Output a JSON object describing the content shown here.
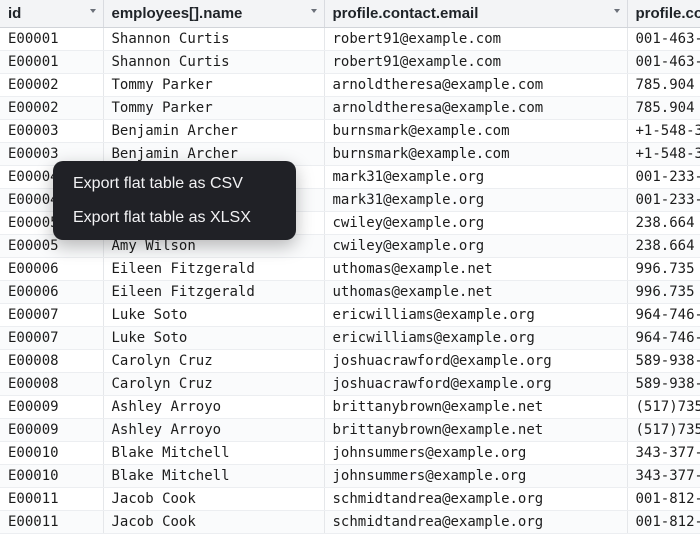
{
  "columns": [
    {
      "key": "id",
      "label": "id"
    },
    {
      "key": "name",
      "label": "employees[].name"
    },
    {
      "key": "email",
      "label": "profile.contact.email"
    },
    {
      "key": "phone",
      "label": "profile.co"
    }
  ],
  "rows": [
    [
      "E00001",
      "Shannon Curtis",
      "robert91@example.com",
      "001-463-"
    ],
    [
      "E00001",
      "Shannon Curtis",
      "robert91@example.com",
      "001-463-"
    ],
    [
      "E00002",
      "Tommy Parker",
      "arnoldtheresa@example.com",
      "785.904"
    ],
    [
      "E00002",
      "Tommy Parker",
      "arnoldtheresa@example.com",
      "785.904"
    ],
    [
      "E00003",
      "Benjamin Archer",
      "burnsmark@example.com",
      "+1-548-3"
    ],
    [
      "E00003",
      "Benjamin Archer",
      "burnsmark@example.com",
      "+1-548-3"
    ],
    [
      "E00004",
      "",
      "mark31@example.org",
      "001-233-"
    ],
    [
      "E00004",
      "",
      "mark31@example.org",
      "001-233-"
    ],
    [
      "E00005",
      "",
      "cwiley@example.org",
      "238.664"
    ],
    [
      "E00005",
      "Amy Wilson",
      "cwiley@example.org",
      "238.664"
    ],
    [
      "E00006",
      "Eileen Fitzgerald",
      "uthomas@example.net",
      "996.735"
    ],
    [
      "E00006",
      "Eileen Fitzgerald",
      "uthomas@example.net",
      "996.735"
    ],
    [
      "E00007",
      "Luke Soto",
      "ericwilliams@example.org",
      "964-746-"
    ],
    [
      "E00007",
      "Luke Soto",
      "ericwilliams@example.org",
      "964-746-"
    ],
    [
      "E00008",
      "Carolyn Cruz",
      "joshuacrawford@example.org",
      "589-938-"
    ],
    [
      "E00008",
      "Carolyn Cruz",
      "joshuacrawford@example.org",
      "589-938-"
    ],
    [
      "E00009",
      "Ashley Arroyo",
      "brittanybrown@example.net",
      "(517)735"
    ],
    [
      "E00009",
      "Ashley Arroyo",
      "brittanybrown@example.net",
      "(517)735"
    ],
    [
      "E00010",
      "Blake Mitchell",
      "johnsummers@example.org",
      "343-377-"
    ],
    [
      "E00010",
      "Blake Mitchell",
      "johnsummers@example.org",
      "343-377-"
    ],
    [
      "E00011",
      "Jacob Cook",
      "schmidtandrea@example.org",
      "001-812-"
    ],
    [
      "E00011",
      "Jacob Cook",
      "schmidtandrea@example.org",
      "001-812-"
    ]
  ],
  "context_menu": {
    "items": [
      {
        "label": "Export flat table as CSV"
      },
      {
        "label": "Export flat table as XLSX"
      }
    ]
  },
  "colors": {
    "menu_bg": "#202126",
    "header_bg": "#f3f4f6"
  }
}
